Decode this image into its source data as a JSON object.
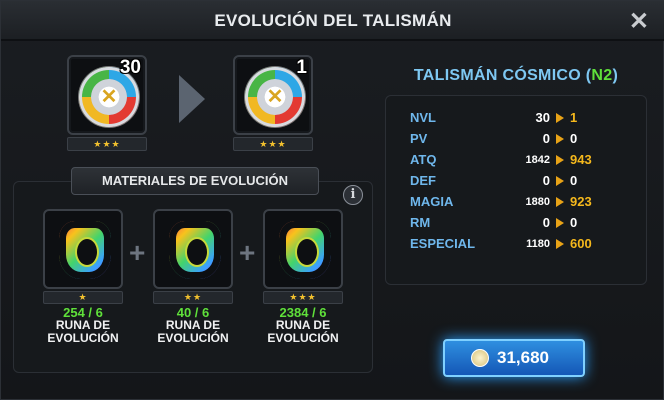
{
  "window": {
    "title": "EVOLUCIÓN DEL TALISMÁN",
    "close_icon": "close-icon"
  },
  "current": {
    "level": "30",
    "stars": "★★★",
    "icon": "talisman-icon"
  },
  "next": {
    "level": "1",
    "stars": "★★★",
    "icon": "talisman-icon"
  },
  "materials": {
    "header": "MATERIALES DE EVOLUCIÓN",
    "info_icon": "i",
    "items": [
      {
        "stars": "★",
        "count": "254 / 6",
        "name_line1": "RUNA DE",
        "name_line2": "EVOLUCIÓN"
      },
      {
        "stars": "★★",
        "count": "40 / 6",
        "name_line1": "RUNA DE",
        "name_line2": "EVOLUCIÓN"
      },
      {
        "stars": "★★★",
        "count": "2384 / 6",
        "name_line1": "RUNA DE",
        "name_line2": "EVOLUCIÓN"
      }
    ],
    "plus": "+"
  },
  "talisman": {
    "name": "TALISMÁN CÓSMICO (",
    "grade": "N2",
    "name_end": ")"
  },
  "stats": [
    {
      "label": "NVL",
      "from": "30",
      "to": "1"
    },
    {
      "label": "PV",
      "from": "0",
      "to": "0"
    },
    {
      "label": "ATQ",
      "from": "1842",
      "to": "943"
    },
    {
      "label": "DEF",
      "from": "0",
      "to": "0"
    },
    {
      "label": "MAGIA",
      "from": "1880",
      "to": "923"
    },
    {
      "label": "RM",
      "from": "0",
      "to": "0"
    },
    {
      "label": "ESPECIAL",
      "from": "1180",
      "to": "600"
    }
  ],
  "colors": {
    "increased": "#f5b81c",
    "unchanged": "#ffffff",
    "label": "#6fb7ec",
    "count": "#5fe03a"
  },
  "cost": {
    "amount": "31,680",
    "icon": "coin-icon"
  }
}
